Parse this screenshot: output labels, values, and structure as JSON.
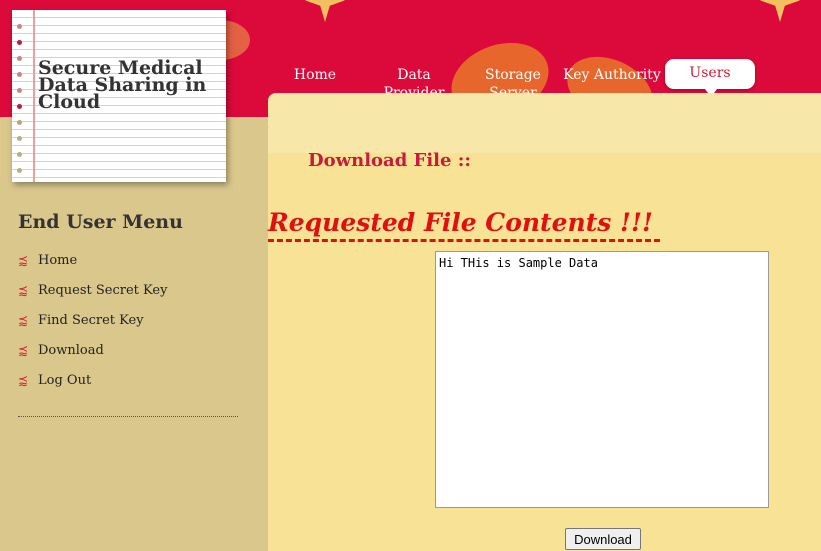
{
  "header": {
    "site_title": "Secure Medical Data Sharing in Cloud",
    "nav": [
      {
        "label": "Home"
      },
      {
        "label": "Data Provider"
      },
      {
        "label": "Storage Server"
      },
      {
        "label": "Key Authority"
      },
      {
        "label": "Users",
        "active": true
      }
    ],
    "colors": {
      "header_bg": "#dc0a3a",
      "accent": "#c81a3a"
    }
  },
  "sidebar": {
    "title": "End User Menu",
    "bullet_icon": "arrow-bullet-icon",
    "items": [
      {
        "label": "Home"
      },
      {
        "label": "Request Secret Key"
      },
      {
        "label": "Find Secret Key"
      },
      {
        "label": "Download"
      },
      {
        "label": "Log Out"
      }
    ]
  },
  "main": {
    "page_title": "Download File ::",
    "contents_title": "Requested File Contents !!!",
    "file_contents": "Hi THis is Sample Data",
    "download_label": "Download"
  }
}
